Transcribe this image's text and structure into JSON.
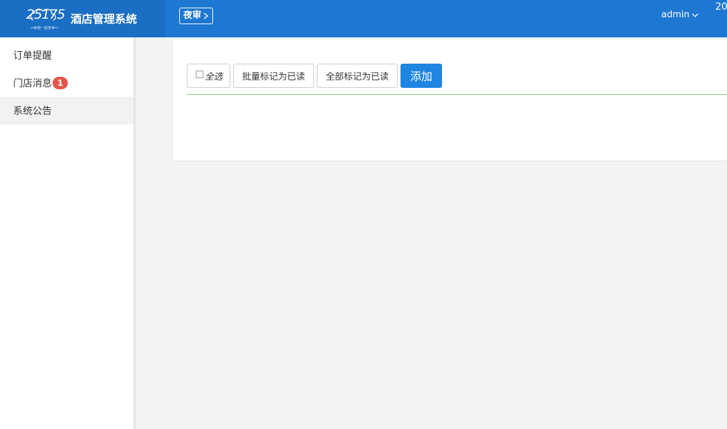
{
  "header": {
    "logo_number": "25175",
    "logo_tagline": "你我一起携手",
    "app_title": "酒店管理系统",
    "night_audit_label": "夜审",
    "username": "admin",
    "corner_clipped_text": "20"
  },
  "sidebar": {
    "items": [
      {
        "label": "订单提醒"
      },
      {
        "label": "门店消息",
        "badge": "1"
      },
      {
        "label": "系统公告",
        "active": true
      }
    ]
  },
  "toolbar": {
    "select_all_label": "全选",
    "mark_selected_read_label": "批量标记为已读",
    "mark_all_read_label": "全部标记为已读",
    "add_label": "添加"
  },
  "colors": {
    "header_bg": "#1e77d0",
    "logo_bg": "#1a6ec4",
    "primary_button": "#1e85e0",
    "badge": "#e4564a",
    "divider": "#8fc27e"
  }
}
